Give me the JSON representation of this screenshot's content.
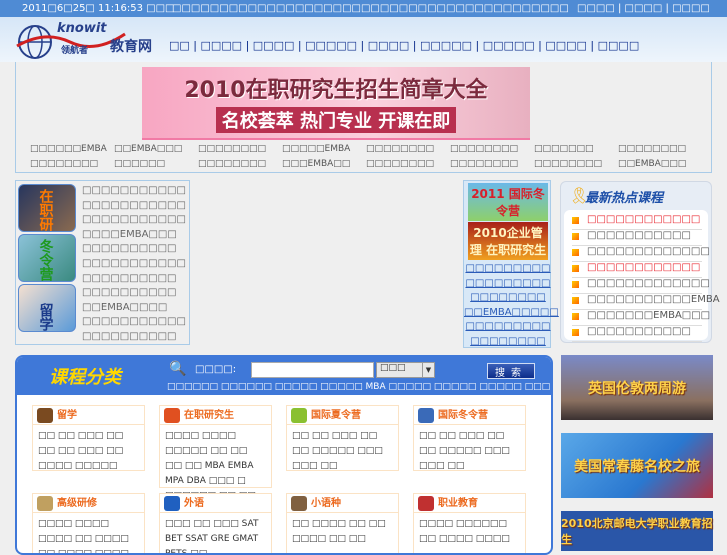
{
  "topbar": {
    "datetime": "2011□6□25□ 11:16:53 □□□",
    "marquee": "□□□□□□□□□□□□□□□□□□□□□□□□□□□□□□□□□□□□□□□□□□",
    "links": [
      "□□□□",
      "□□□□",
      "□□□□"
    ]
  },
  "logo": {
    "brand": "knowit",
    "sub": "领航者",
    "name": "教育网"
  },
  "nav": [
    "□□",
    "□□□□",
    "□□□□",
    "□□□□□",
    "□□□□",
    "□□□□□",
    "□□□□□",
    "□□□□",
    "□□□□"
  ],
  "banner": {
    "line1": "2010在职研究生招生简章大全",
    "line2": "名校荟萃 热门专业 开课在即"
  },
  "grid_links": [
    [
      "□□□□□□EMBA",
      "□□EMBA□□□",
      "□□□□□□□□",
      "□□□□□EMBA",
      "□□□□□□□□",
      "□□□□□□□□",
      "□□□□□□□",
      "□□□□□□□□"
    ],
    [
      "□□□□□□□□",
      "□□□□□□",
      "□□□□□□□□",
      "□□□EMBA□□",
      "□□□□□□□□",
      "□□□□□□□□",
      "□□□□□□□□",
      "□□EMBA□□□"
    ]
  ],
  "left_panel": {
    "images": [
      "在职研",
      "冬令营",
      "留学"
    ],
    "items": [
      "□□□□□□□□□□□",
      "□□□□□□□□□□□",
      "□□□□□□□□□□□",
      "□□□□EMBA□□□",
      "□□□□□□□□□□",
      "□□□□□□□□□□□",
      "□□□□□□□□□□",
      "□□□□□□□□□□",
      "□□EMBA□□□□",
      "□□□□□□□□□□□",
      "□□□□□□□□□□"
    ]
  },
  "mid_panel": {
    "images": [
      "2011 国际冬令营",
      "2010企业管理 在职研究生"
    ],
    "links": [
      "□□□□□□□□□",
      "□□□□□□□□□",
      "□□□□□□□□",
      "□□EMBA□□□□□",
      "□□□□□□□□□",
      "□□□□□□□□"
    ]
  },
  "hot_courses": {
    "title": "最新热点课程",
    "items": [
      {
        "text": "□□□□□□□□□□□□",
        "color": "#e8202a"
      },
      {
        "text": "□□□□□□□□□□□",
        "color": "#555555"
      },
      {
        "text": "□□□□□□□□□□□□□",
        "color": "#555555"
      },
      {
        "text": "□□□□□□□□□□□□",
        "color": "#e8202a"
      },
      {
        "text": "□□□□□□□□□□□□□",
        "color": "#555555"
      },
      {
        "text": "□□□□□□□□□□□EMBA",
        "color": "#555555"
      },
      {
        "text": "□□□□□□□EMBA□□□",
        "color": "#555555"
      },
      {
        "text": "□□□□□□□□□□□",
        "color": "#555555"
      }
    ]
  },
  "categories": {
    "title": "课程分类",
    "search_label": "□□□□:",
    "search_value": "",
    "select_value": "□□□",
    "search_button": "搜索",
    "hotwords": "□□□□□□ □□□□□□ □□□□□ □□□□□ MBA □□□□□ □□□□□ □□□□□ □□□□□ □□",
    "cards": [
      {
        "title": "留学",
        "body": "□□ □□ □□□ □□ □□ □□ □□□ □□ □□□□ □□□□□"
      },
      {
        "title": "在职研究生",
        "body": "□□□□ □□□□ □□□□□ □□ □□ □□ □□ MBA EMBA MPA DBA □□□ □ □□□□□□ □□ □□"
      },
      {
        "title": "国际夏令营",
        "body": "□□ □□ □□□ □□ □□ □□□□□ □□□ □□□ □□"
      },
      {
        "title": "国际冬令营",
        "body": "□□ □□ □□□ □□ □□ □□□□□ □□□ □□□ □□"
      },
      {
        "title": "高级研修",
        "body": "□□□□ □□□□ □□□□ □□ □□□□ □□ □□□□ □□□□ □□ □□"
      },
      {
        "title": "外语",
        "body": "□□□ □□ □□□ SAT BET SSAT GRE GMAT PETS □□"
      },
      {
        "title": "小语种",
        "body": "□□ □□□□ □□ □□ □□□□ □□ □□"
      },
      {
        "title": "职业教育",
        "body": "□□□□ □□□□□□ □□ □□□□ □□□□"
      }
    ]
  },
  "right_banners": [
    "英国伦敦两周游",
    "美国常春藤名校之旅",
    "2010北京邮电大学职业教育招生"
  ]
}
